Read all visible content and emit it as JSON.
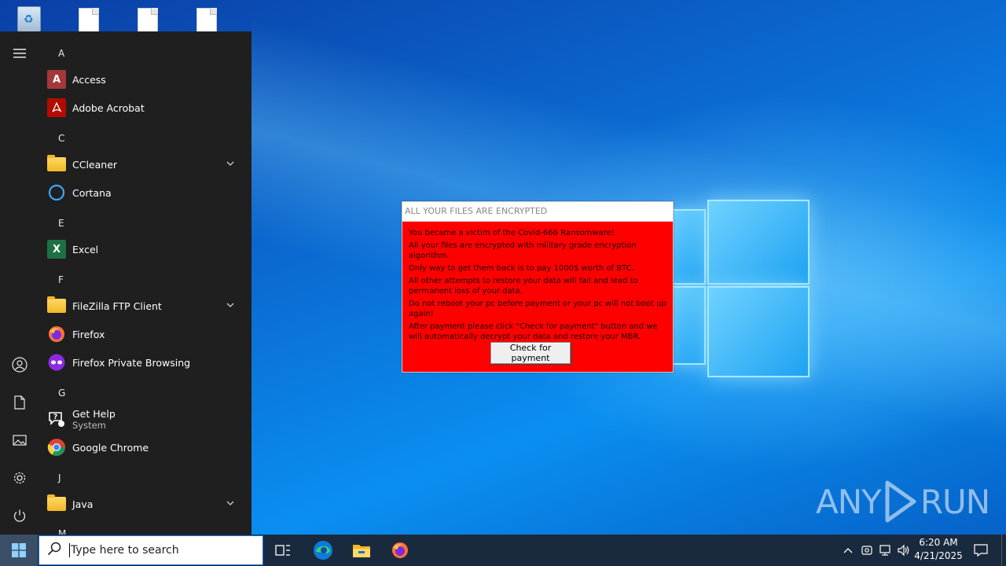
{
  "start_menu": {
    "rail": {
      "hamburger_icon": "hamburger-icon",
      "account_icon": "user-icon",
      "documents_icon": "document-icon",
      "pictures_icon": "picture-icon",
      "settings_icon": "gear-icon",
      "power_icon": "power-icon"
    },
    "letters": {
      "a": "A",
      "c": "C",
      "e": "E",
      "f": "F",
      "g": "G",
      "j": "J",
      "m": "M"
    },
    "apps": {
      "access": "Access",
      "acrobat": "Adobe Acrobat",
      "ccleaner": "CCleaner",
      "cortana": "Cortana",
      "excel": "Excel",
      "filezilla": "FileZilla FTP Client",
      "firefox": "Firefox",
      "firefox_private": "Firefox Private Browsing",
      "get_help": "Get Help",
      "get_help_sub": "System",
      "chrome": "Google Chrome",
      "java": "Java"
    }
  },
  "ransom_window": {
    "title": "ALL YOUR FILES ARE ENCRYPTED",
    "lines": [
      "You became a victim of the Covid-666 Ransomware!",
      "All your files are encrypted with military grade encryption algorithm.",
      "Only way to get them back is to pay 1000$ worth of BTC.",
      "All other attempts to restore your data will fail and lead to permanent loss of your data.",
      "Do not reboot your pc before payment or your pc will not boot up again!",
      "After payment please click \"Check for payment\" button and we will automatically decrypt your data and restore your MBR."
    ],
    "button_label": "Check for payment"
  },
  "watermark": {
    "left": "ANY",
    "right": "RUN"
  },
  "taskbar": {
    "search_placeholder": "Type here to search",
    "clock_time": "6:20 AM",
    "clock_date": "4/21/2025"
  },
  "colors": {
    "ransom_bg": "#ff0000",
    "start_menu_bg": "#1f1f1f",
    "taskbar_bg": "#1a2a3e",
    "accent": "#1a73d9"
  }
}
